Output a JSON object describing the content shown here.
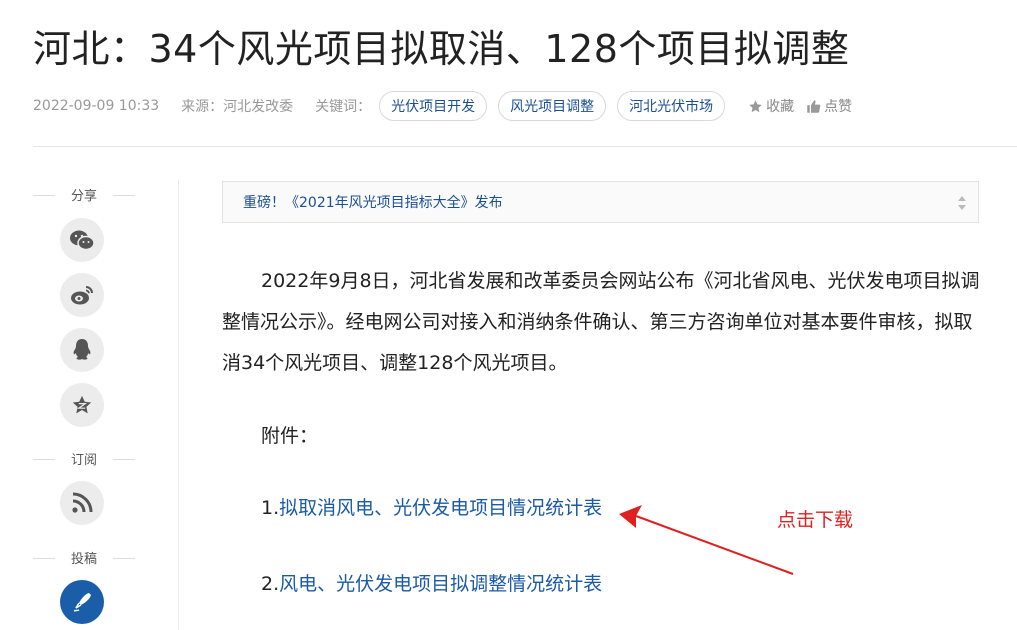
{
  "article": {
    "title": "河北：34个风光项目拟取消、128个项目拟调整",
    "date": "2022-09-09 10:33",
    "source": "来源：河北发改委",
    "keywords_label": "关键词：",
    "keywords": [
      "光伏项目开发",
      "风光项目调整",
      "河北光伏市场"
    ],
    "favorite_label": "收藏",
    "like_label": "点赞"
  },
  "sidebar": {
    "share_label": "分享",
    "subscribe_label": "订阅",
    "submit_label": "投稿",
    "share_icons": [
      "wechat-icon",
      "weibo-icon",
      "qq-icon",
      "qzone-icon"
    ],
    "subscribe_icon": "rss-icon",
    "submit_icon": "pen-icon"
  },
  "notice": {
    "text": "重磅！《2021年风光项目指标大全》发布"
  },
  "body": {
    "paragraph": "2022年9月8日，河北省发展和改革委员会网站公布《河北省风电、光伏发电项目拟调整情况公示》。经电网公司对接入和消纳条件确认、第三方咨询单位对基本要件审核，拟取消34个风光项目、调整128个风光项目。",
    "attachments_label": "附件：",
    "attachments": [
      {
        "num": "1.",
        "title": "拟取消风电、光伏发电项目情况统计表"
      },
      {
        "num": "2.",
        "title": "风电、光伏发电项目拟调整情况统计表"
      }
    ]
  },
  "annotation": {
    "text": "点击下载",
    "color": "#e02020"
  },
  "colors": {
    "link": "#1b5aa6",
    "tag_text": "#1b4f93",
    "submit_circle": "#1a5ea9"
  }
}
